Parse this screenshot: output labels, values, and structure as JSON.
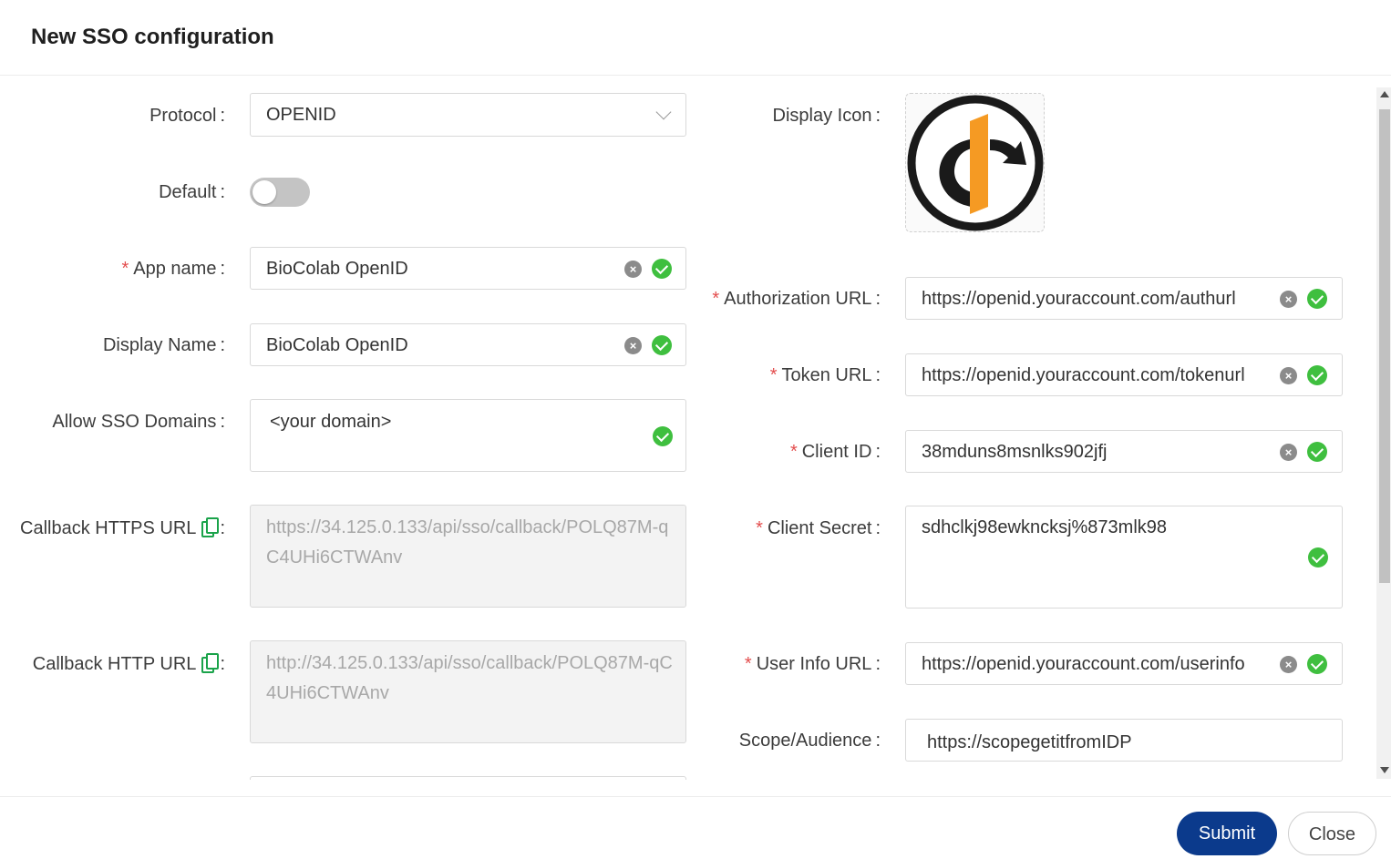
{
  "dialog": {
    "title": "New SSO configuration"
  },
  "left": {
    "protocol": {
      "label": "Protocol",
      "value": "OPENID"
    },
    "default": {
      "label": "Default",
      "on": false
    },
    "app_name": {
      "label": "App name",
      "value": "BioColab OpenID"
    },
    "display_name": {
      "label": "Display Name",
      "value": "BioColab OpenID"
    },
    "allow_domains": {
      "label": "Allow SSO Domains",
      "value": "<your domain>"
    },
    "callback_https": {
      "label": "Callback HTTPS URL",
      "value": "https://34.125.0.133/api/sso/callback/POLQ87M-qC4UHi6CTWAnv"
    },
    "callback_http": {
      "label": "Callback HTTP URL",
      "value": "http://34.125.0.133/api/sso/callback/POLQ87M-qC4UHi6CTWAnv"
    }
  },
  "right": {
    "display_icon": {
      "label": "Display Icon",
      "icon": "openid-logo"
    },
    "auth_url": {
      "label": "Authorization URL",
      "value": "https://openid.youraccount.com/authurl"
    },
    "token_url": {
      "label": "Token URL",
      "value": "https://openid.youraccount.com/tokenurl"
    },
    "client_id": {
      "label": "Client ID",
      "value": "38mduns8msnlks902jfj"
    },
    "client_secret": {
      "label": "Client Secret",
      "value": "sdhclkj98ewkncksj%873mlk98"
    },
    "user_info_url": {
      "label": "User Info URL",
      "value": "https://openid.youraccount.com/userinfo"
    },
    "scope": {
      "label": "Scope/Audience",
      "value": "https://scopegetitfromIDP"
    }
  },
  "footer": {
    "submit": "Submit",
    "close": "Close"
  },
  "colors": {
    "primary": "#0b3a8c",
    "required": "#e34d4d",
    "valid": "#3fbf3f",
    "logo_orange": "#f59a23"
  }
}
